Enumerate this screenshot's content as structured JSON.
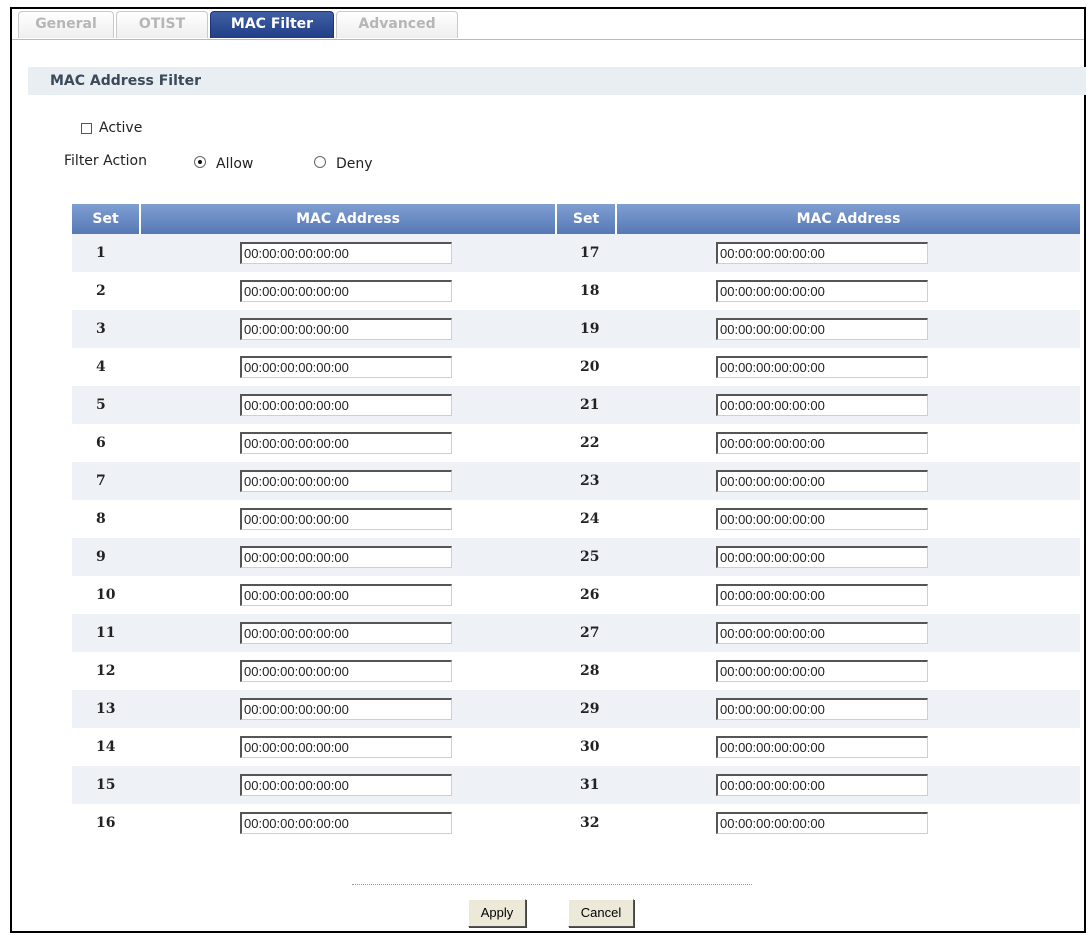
{
  "tabs": [
    {
      "label": "General",
      "active": false
    },
    {
      "label": "OTIST",
      "active": false
    },
    {
      "label": "MAC Filter",
      "active": true
    },
    {
      "label": "Advanced",
      "active": false
    }
  ],
  "section_title": "MAC Address Filter",
  "active_checkbox": {
    "label": "Active",
    "checked": false
  },
  "filter_action": {
    "label": "Filter Action",
    "options": [
      {
        "label": "Allow",
        "selected": true
      },
      {
        "label": "Deny",
        "selected": false
      }
    ]
  },
  "table": {
    "headers": [
      "Set",
      "MAC Address",
      "Set",
      "MAC Address"
    ],
    "rows": [
      {
        "left_set": "1",
        "left_mac": "00:00:00:00:00:00",
        "right_set": "17",
        "right_mac": "00:00:00:00:00:00"
      },
      {
        "left_set": "2",
        "left_mac": "00:00:00:00:00:00",
        "right_set": "18",
        "right_mac": "00:00:00:00:00:00"
      },
      {
        "left_set": "3",
        "left_mac": "00:00:00:00:00:00",
        "right_set": "19",
        "right_mac": "00:00:00:00:00:00"
      },
      {
        "left_set": "4",
        "left_mac": "00:00:00:00:00:00",
        "right_set": "20",
        "right_mac": "00:00:00:00:00:00"
      },
      {
        "left_set": "5",
        "left_mac": "00:00:00:00:00:00",
        "right_set": "21",
        "right_mac": "00:00:00:00:00:00"
      },
      {
        "left_set": "6",
        "left_mac": "00:00:00:00:00:00",
        "right_set": "22",
        "right_mac": "00:00:00:00:00:00"
      },
      {
        "left_set": "7",
        "left_mac": "00:00:00:00:00:00",
        "right_set": "23",
        "right_mac": "00:00:00:00:00:00"
      },
      {
        "left_set": "8",
        "left_mac": "00:00:00:00:00:00",
        "right_set": "24",
        "right_mac": "00:00:00:00:00:00"
      },
      {
        "left_set": "9",
        "left_mac": "00:00:00:00:00:00",
        "right_set": "25",
        "right_mac": "00:00:00:00:00:00"
      },
      {
        "left_set": "10",
        "left_mac": "00:00:00:00:00:00",
        "right_set": "26",
        "right_mac": "00:00:00:00:00:00"
      },
      {
        "left_set": "11",
        "left_mac": "00:00:00:00:00:00",
        "right_set": "27",
        "right_mac": "00:00:00:00:00:00"
      },
      {
        "left_set": "12",
        "left_mac": "00:00:00:00:00:00",
        "right_set": "28",
        "right_mac": "00:00:00:00:00:00"
      },
      {
        "left_set": "13",
        "left_mac": "00:00:00:00:00:00",
        "right_set": "29",
        "right_mac": "00:00:00:00:00:00"
      },
      {
        "left_set": "14",
        "left_mac": "00:00:00:00:00:00",
        "right_set": "30",
        "right_mac": "00:00:00:00:00:00"
      },
      {
        "left_set": "15",
        "left_mac": "00:00:00:00:00:00",
        "right_set": "31",
        "right_mac": "00:00:00:00:00:00"
      },
      {
        "left_set": "16",
        "left_mac": "00:00:00:00:00:00",
        "right_set": "32",
        "right_mac": "00:00:00:00:00:00"
      }
    ]
  },
  "buttons": {
    "apply": "Apply",
    "cancel": "Cancel"
  },
  "colors": {
    "tab_active_bg": "#2b4a92",
    "table_header_bg": "#6a8cc6",
    "section_header_bg": "#e9eef2",
    "row_alt_bg": "#eef2f6"
  }
}
